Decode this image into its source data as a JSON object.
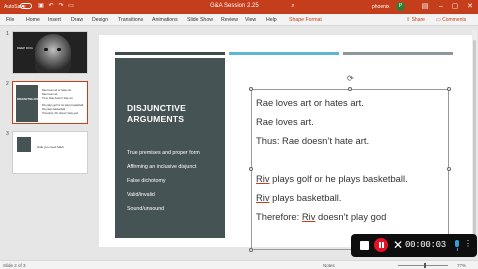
{
  "titlebar": {
    "autosave": "AutoSave",
    "document_title": "G&A Session 2.25",
    "user": "phoenix",
    "avatar_initial": "P"
  },
  "ribbon": {
    "tabs": [
      "File",
      "Home",
      "Insert",
      "Draw",
      "Design",
      "Transitions",
      "Animations",
      "Slide Show",
      "Review",
      "View",
      "Help",
      "Shape Format"
    ],
    "active_tab": "Shape Format",
    "share": "Share",
    "comments": "Comments"
  },
  "thumbnails": {
    "numbers": [
      "1",
      "2",
      "3"
    ],
    "slide1_title": "DEEP DOG",
    "slide2_heading": "DISJUNCTIVE ARGUMENTS",
    "slide2_lines": [
      "Rae loves art or hates art.",
      "Rae loves art.",
      "Thus: Rae doesn't hate art.",
      "Riv plays golf or he plays basketball.",
      "Riv plays basketball.",
      "Therefore: Riv doesn't play god"
    ],
    "slide3_text": "Hide you need Mark"
  },
  "slide": {
    "title_line1": "DISJUNCTIVE",
    "title_line2": "ARGUMENTS",
    "bullets": [
      "True premises and proper form",
      "Affirming an inclusive disjunct",
      "False dichotomy",
      "Valid/invalid",
      "Sound/unsound"
    ],
    "lines": {
      "l1": "Rae loves art or hates art.",
      "l2": "Rae loves art.",
      "l3": "Thus: Rae doesn’t hate art.",
      "l4_riv": "Riv",
      "l4_rest": " plays golf or he plays basketball.",
      "l5_riv": "Riv",
      "l5_rest": " plays basketball.",
      "l6_pre": "Therefore: ",
      "l6_riv": "Riv",
      "l6_rest": " doesn’t play god"
    },
    "bar_colors": [
      "#404b4c",
      "#5bb7d4",
      "#8c9899"
    ]
  },
  "recorder": {
    "time": "00:00:03"
  },
  "statusbar": {
    "slide_info": "Slide 2 of 3",
    "notes": "Notes",
    "zoom": "77%"
  },
  "colors": {
    "accent": "#c43e1c",
    "panel": "#465354",
    "record": "#e81123"
  }
}
